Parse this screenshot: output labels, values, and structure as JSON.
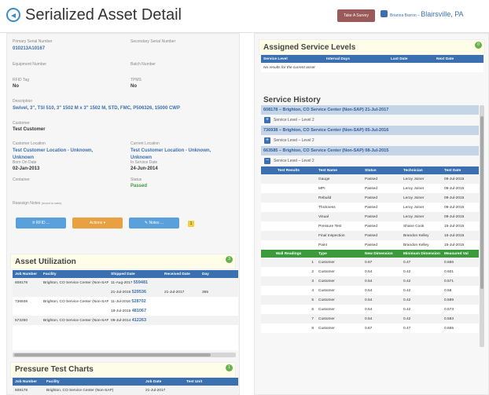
{
  "header": {
    "title": "Serialized Asset Detail",
    "survey_label": "Take A Survey",
    "user_name": "Brianna Barron",
    "location": "Blairsville, PA"
  },
  "details": {
    "primary_serial": {
      "label": "Primary Serial Number",
      "value": "010213A10167"
    },
    "secondary_serial": {
      "label": "Secondary Serial Number",
      "value": ""
    },
    "equipment_number": {
      "label": "Equipment Number",
      "value": ""
    },
    "batch_number": {
      "label": "Batch Number",
      "value": ""
    },
    "rfid_tag": {
      "label": "RFID Tag",
      "value": "No"
    },
    "tpms": {
      "label": "TPMS",
      "value": "No"
    },
    "description": {
      "label": "Description",
      "value": "Swivel, 3\", TSI 510, 3\" 1502 M x 3\" 1502 M, STD, FMC, P506326, 15000 CWP"
    },
    "customer": {
      "label": "Customer",
      "value": "Test Customer"
    },
    "customer_location": {
      "label": "Customer Location",
      "value": "Test Customer Location - Unknown, Unknown"
    },
    "current_location": {
      "label": "Current Location",
      "value": "Test Customer Location - Unknown, Unknown"
    },
    "born_on": {
      "label": "Born On Date",
      "value": "02-Jan-2013"
    },
    "in_service": {
      "label": "In Service Date",
      "value": "24-Jun-2014"
    },
    "container": {
      "label": "Container",
      "value": ""
    },
    "status": {
      "label": "Status",
      "value": "Passed"
    },
    "reassign_notes": {
      "label": "Reassign Notes",
      "hint": "(record to notes)"
    }
  },
  "actions": {
    "rfid": "RFID ...",
    "actions": "Actions ▾",
    "notes": "Notes ...",
    "notes_count": "1"
  },
  "colors": {
    "rfid": "#5aa0dc",
    "actions": "#e8a040",
    "notes": "#5aa0dc",
    "badge": "#6ab04c",
    "table_header": "#3a6fb0",
    "wall_header": "#3c9a3c"
  },
  "asset_utilization": {
    "title": "Asset Utilization",
    "badge": "3",
    "columns": [
      "Job Number",
      "Facility",
      "Shipped Date",
      "Received Date",
      "Day"
    ],
    "rows": [
      {
        "job": "608178",
        "facility": "Brighton, CO Service Center (Non-SAP)",
        "shipped": "11-Aug-2017",
        "shipped_link": "559481",
        "received": "",
        "days": ""
      },
      {
        "job": "",
        "facility": "",
        "shipped": "21-Jul-2016",
        "shipped_link": "529536",
        "received": "21-Jul-2017",
        "days": "365"
      },
      {
        "job": "736938",
        "facility": "Brighton, CO Service Center (Non-SAP)",
        "shipped": "11-Jul-2016",
        "shipped_link": "528702",
        "received": "",
        "days": ""
      },
      {
        "job": "",
        "facility": "",
        "shipped": "18-Jul-2015",
        "shipped_link": "481067",
        "received": "",
        "days": ""
      },
      {
        "job": "572250",
        "facility": "Brighton, CO Service Center (Non-SAP)",
        "shipped": "09-Jul-2014",
        "shipped_link": "412263",
        "received": "",
        "days": ""
      }
    ]
  },
  "pressure_test": {
    "title": "Pressure Test Charts",
    "badge": "1",
    "columns": [
      "Job Number",
      "Facility",
      "Job Date",
      "Test Unit"
    ],
    "rows": [
      {
        "job": "608178",
        "facility": "Brighton, CO Service Center (Non-SAP)",
        "date": "21-Jul-2017",
        "unit": ""
      }
    ]
  },
  "service_levels": {
    "title": "Assigned Service Levels",
    "badge": "0",
    "columns": [
      "Service Level",
      "Interval Days",
      "Last Date",
      "Next Date"
    ],
    "empty": "No results for the current asset"
  },
  "service_history": {
    "title": "Service History",
    "groups": [
      {
        "header": "608178 – Brighton, CO Service Center (Non-SAP)  21-Jul-2017",
        "level": "Service Level – Level 2"
      },
      {
        "header": "736938 – Brighton, CO Service Center (Non-SAP)  05-Jul-2016",
        "level": "Service Level – Level 2"
      },
      {
        "header": "663585 – Brighton, CO Service Center (Non-SAP)  08-Jul-2015",
        "level": "Service Level – Level 2"
      }
    ],
    "test_columns": [
      "Test Results",
      "Test Name",
      "Status",
      "Technician",
      "Test Date"
    ],
    "tests": [
      {
        "name": "Gauge",
        "status": "Passed",
        "tech": "Leroy Joiner",
        "date": "09-Jul-2015"
      },
      {
        "name": "MPI",
        "status": "Passed",
        "tech": "Leroy Joiner",
        "date": "09-Jul-2015"
      },
      {
        "name": "Rebuild",
        "status": "Passed",
        "tech": "Leroy Joiner",
        "date": "09-Jul-2015"
      },
      {
        "name": "Thickness",
        "status": "Passed",
        "tech": "Leroy Joiner",
        "date": "09-Jul-2015"
      },
      {
        "name": "Visual",
        "status": "Passed",
        "tech": "Leroy Joiner",
        "date": "09-Jul-2015"
      },
      {
        "name": "Pressure Test",
        "status": "Passed",
        "tech": "Shane Cook",
        "date": "15-Jul-2015"
      },
      {
        "name": "Final Inspection",
        "status": "Passed",
        "tech": "Brandon Kelley",
        "date": "15-Jul-2015"
      },
      {
        "name": "Paint",
        "status": "Passed",
        "tech": "Brandon Kelley",
        "date": "15-Jul-2015"
      }
    ],
    "wall_columns": [
      "Wall Readings",
      "Type",
      "New Dimension",
      "Minimum Dimension",
      "Measured Val"
    ],
    "walls": [
      {
        "n": "1",
        "type": "Customer",
        "new": "0.67",
        "min": "0.47",
        "meas": "0.656"
      },
      {
        "n": "2",
        "type": "Customer",
        "new": "0.54",
        "min": "0.42",
        "meas": "0.601"
      },
      {
        "n": "3",
        "type": "Customer",
        "new": "0.54",
        "min": "0.42",
        "meas": "0.571"
      },
      {
        "n": "4",
        "type": "Customer",
        "new": "0.54",
        "min": "0.42",
        "meas": "0.58"
      },
      {
        "n": "5",
        "type": "Customer",
        "new": "0.54",
        "min": "0.42",
        "meas": "0.589"
      },
      {
        "n": "6",
        "type": "Customer",
        "new": "0.54",
        "min": "0.42",
        "meas": "0.573"
      },
      {
        "n": "7",
        "type": "Customer",
        "new": "0.54",
        "min": "0.42",
        "meas": "0.583"
      },
      {
        "n": "8",
        "type": "Customer",
        "new": "0.67",
        "min": "0.47",
        "meas": "0.655"
      }
    ]
  }
}
